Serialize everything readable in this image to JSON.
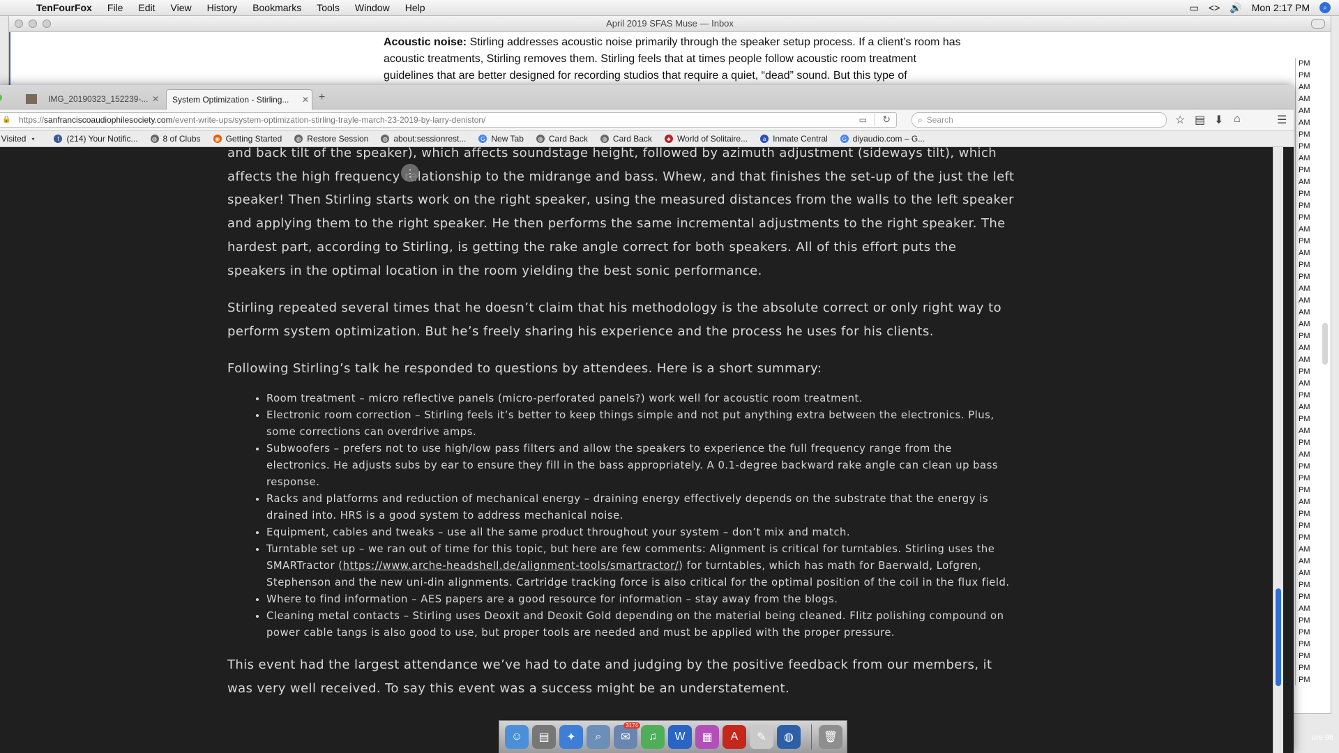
{
  "menubar": {
    "app": "TenFourFox",
    "items": [
      "File",
      "Edit",
      "View",
      "History",
      "Bookmarks",
      "Tools",
      "Window",
      "Help"
    ],
    "clock": "Mon 2:17 PM",
    "code_icon": "<>"
  },
  "mail": {
    "title": "April 2019 SFAS Muse — Inbox",
    "body_bold": "Acoustic noise:",
    "body_text": " Stirling addresses acoustic noise primarily through the speaker setup process.  If a client’s room has acoustic treatments, Stirling removes them.  Stirling feels that at times people follow acoustic room treatment guidelines that are better designed for recording studios that require a quiet, “dead” sound.  But this type of",
    "side_times": [
      "PM",
      "PM",
      "AM",
      "AM",
      "AM",
      "AM",
      "PM",
      "PM",
      "AM",
      "PM",
      "AM",
      "PM",
      "PM",
      "PM",
      "AM",
      "PM",
      "AM",
      "PM",
      "PM",
      "AM",
      "AM",
      "AM",
      "AM",
      "PM",
      "AM",
      "AM",
      "PM",
      "AM",
      "PM",
      "AM",
      "PM",
      "AM",
      "PM",
      "AM",
      "PM",
      "PM",
      "PM",
      "AM",
      "PM",
      "PM",
      "PM",
      "AM",
      "AM",
      "AM",
      "PM",
      "PM",
      "AM",
      "PM",
      "PM",
      "PM",
      "PM",
      "PM",
      "PM"
    ]
  },
  "browser": {
    "tabs": [
      {
        "title": "IMG_20190323_152239-...",
        "active": false
      },
      {
        "title": "System Optimization - Stirling...",
        "active": true
      }
    ],
    "url_scheme": "https://",
    "url_host": "sanfranciscoaudiophilesociety.com",
    "url_path": "/event-write-ups/system-optimization-stirling-trayle-march-23-2019-by-larry-deniston/",
    "search_placeholder": "Search",
    "bookmarks": [
      {
        "label": "t Visited",
        "icon": "dropdown-icon"
      },
      {
        "label": "(214) Your Notific...",
        "icon": "facebook-icon"
      },
      {
        "label": "8 of Clubs",
        "icon": "globe-icon"
      },
      {
        "label": "Getting Started",
        "icon": "firefox-icon"
      },
      {
        "label": "Restore Session",
        "icon": "globe-icon"
      },
      {
        "label": "about:sessionrest...",
        "icon": "globe-icon"
      },
      {
        "label": "New Tab",
        "icon": "google-icon"
      },
      {
        "label": "Card Back",
        "icon": "globe-icon"
      },
      {
        "label": "Card Back",
        "icon": "globe-icon"
      },
      {
        "label": "World of Solitaire...",
        "icon": "solitaire-icon"
      },
      {
        "label": "Inmate Central",
        "icon": "inmate-icon"
      },
      {
        "label": "diyaudio.com – G...",
        "icon": "google-icon"
      }
    ]
  },
  "article": {
    "p1": "and back tilt of the speaker), which affects soundstage height, followed by azimuth adjustment (sideways tilt), which affects the high frequency relationship to the midrange and bass.  Whew, and that finishes the set-up of the just the left speaker!  Then Stirling starts work on the right speaker, using the measured distances from the walls to the left speaker and applying them to the right speaker.  He then performs the same incremental adjustments to the right speaker.  The hardest part, according to Stirling, is getting the rake angle correct for both speakers.  All of this effort puts the speakers in the optimal location in the room yielding the best sonic performance.",
    "p2": "Stirling repeated several times that he doesn’t claim that his methodology is the absolute correct or only right way to perform system optimization.  But he’s freely sharing his experience and the process he uses for his clients.",
    "p3": "Following Stirling’s talk he responded to questions by attendees.  Here is a short summary:",
    "bullets": [
      "Room treatment – micro reflective panels (micro-perforated panels?) work well for acoustic room treatment.",
      "Electronic room correction – Stirling feels it’s better to keep things simple and not put anything extra between the electronics. Plus, some corrections can overdrive amps.",
      "Subwoofers – prefers not to use high/low pass filters and allow the speakers to experience the full frequency range from the electronics. He adjusts subs by ear to ensure they fill in the bass appropriately.  A 0.1-degree backward rake angle can clean up bass response.",
      "Racks and platforms and reduction of mechanical energy – draining energy effectively depends on the substrate that the energy is drained into. HRS is a good system to address mechanical noise.",
      "Equipment, cables and tweaks – use all the same product throughout your system – don’t mix and match."
    ],
    "turntable_pre": "Turntable set up – we ran out of time for this topic, but here are few comments: Alignment is critical for turntables.  Stirling uses the SMARTractor (",
    "turntable_link": "https://www.arche-headshell.de/alignment-tools/smartractor/",
    "turntable_post": ") for turntables, which has math for Baerwald, Lofgren, Stephenson and the new uni-din alignments.  Cartridge tracking force is also critical for the optimal position of the coil in the flux field.",
    "bullets_after": [
      "Where to find information – AES papers are a good resource for information – stay away from the blogs.",
      "Cleaning metal contacts – Stirling uses Deoxit and Deoxit Gold depending on the material being cleaned. Flitz polishing compound on power cable tangs is also good to use, but proper tools are needed and must be applied with the proper pressure."
    ],
    "p4": "This event had the largest attendance we’ve had to date and judging by the positive feedback from our members, it was very well received.   To say this event was a success might be an understatement."
  },
  "dock": {
    "mail_badge": "3174",
    "items": [
      "finder-icon",
      "hard-drive-icon",
      "safari-icon",
      "preview-icon",
      "mail-icon",
      "itunes-icon",
      "word-icon",
      "ical-icon",
      "acrobat-icon",
      "textedit-icon",
      "tenfourfox-icon",
      "trash-icon"
    ]
  },
  "corner_label": "ure 98",
  "colors": {
    "page_bg": "#1f1f1f",
    "article_text": "#d9d9d9",
    "scroll_thumb": "#2f6fd3"
  }
}
